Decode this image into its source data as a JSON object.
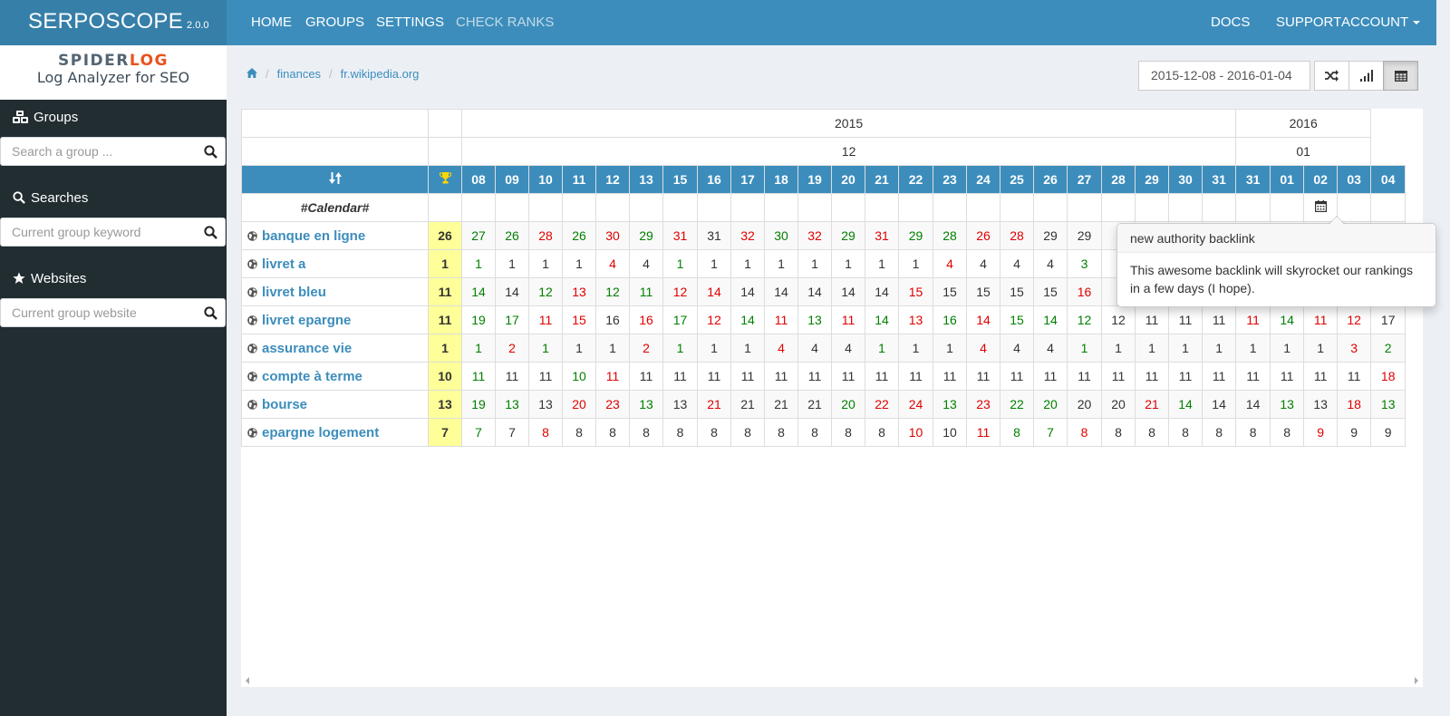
{
  "navbar": {
    "brand": "SERPOSCOPE",
    "version": "2.0.0",
    "left_links": [
      "HOME",
      "GROUPS",
      "SETTINGS",
      "CHECK RANKS"
    ],
    "right_links": [
      "DOCS",
      "SUPPORT",
      "ACCOUNT"
    ]
  },
  "sidebar": {
    "logo_line1_a": "SPIDER",
    "logo_line1_b": "LOG",
    "logo_line2": "Log Analyzer for SEO",
    "groups_label": "Groups",
    "groups_placeholder": "Search a group ...",
    "searches_label": "Searches",
    "searches_placeholder": "Current group keyword",
    "websites_label": "Websites",
    "websites_placeholder": "Current group website"
  },
  "breadcrumb": [
    "finances",
    "fr.wikipedia.org"
  ],
  "toolbar": {
    "daterange": "2015-12-08 - 2016-01-04"
  },
  "table": {
    "years": [
      {
        "label": "2015",
        "span": 23
      },
      {
        "label": "2016",
        "span": 4
      }
    ],
    "months": [
      {
        "label": "12",
        "span": 23
      },
      {
        "label": "01",
        "span": 4
      }
    ],
    "days": [
      "08",
      "09",
      "10",
      "11",
      "12",
      "13",
      "15",
      "16",
      "17",
      "18",
      "19",
      "20",
      "21",
      "22",
      "23",
      "24",
      "25",
      "26",
      "27",
      "28",
      "29",
      "30",
      "31",
      "31",
      "01",
      "02",
      "03",
      "04"
    ],
    "calendar_label": "#Calendar#",
    "calendar_event_index": 25,
    "rows": [
      {
        "keyword": "banque en ligne",
        "best": "26",
        "ranks": [
          "27",
          "26",
          "28",
          "26",
          "30",
          "29",
          "31",
          "31",
          "32",
          "30",
          "32",
          "29",
          "31",
          "29",
          "28",
          "26",
          "28",
          "29",
          "29",
          "",
          "",
          "",
          "",
          "",
          "",
          "",
          "",
          ""
        ],
        "colors": "ggrgrgrnrgrgrggrrn.........."
      },
      {
        "keyword": "livret a",
        "best": "1",
        "ranks": [
          "1",
          "1",
          "1",
          "1",
          "4",
          "4",
          "1",
          "1",
          "1",
          "1",
          "1",
          "1",
          "1",
          "1",
          "4",
          "4",
          "4",
          "4",
          "3",
          "",
          "",
          "",
          "",
          "",
          "",
          "",
          "",
          ""
        ],
        "colors": "gnnnrngnnnnnnnrnnng........."
      },
      {
        "keyword": "livret bleu",
        "best": "11",
        "ranks": [
          "14",
          "14",
          "12",
          "13",
          "12",
          "11",
          "12",
          "14",
          "14",
          "14",
          "14",
          "14",
          "14",
          "15",
          "15",
          "15",
          "15",
          "15",
          "16",
          "",
          "",
          "",
          "",
          "",
          "",
          "",
          "",
          ""
        ],
        "colors": "gngrggrrnnnnnrnnnnr........."
      },
      {
        "keyword": "livret epargne",
        "best": "11",
        "ranks": [
          "19",
          "17",
          "11",
          "15",
          "16",
          "16",
          "17",
          "12",
          "14",
          "11",
          "13",
          "11",
          "14",
          "13",
          "16",
          "14",
          "15",
          "14",
          "12",
          "12",
          "11",
          "11",
          "11",
          "11",
          "14",
          "11",
          "12",
          "17"
        ],
        "colors": "ggrrnrgrgrgrgrgrgggnnnnrgrr"
      },
      {
        "keyword": "assurance vie",
        "best": "1",
        "ranks": [
          "1",
          "2",
          "1",
          "1",
          "1",
          "2",
          "1",
          "1",
          "1",
          "4",
          "4",
          "4",
          "1",
          "1",
          "1",
          "4",
          "4",
          "4",
          "1",
          "1",
          "1",
          "1",
          "1",
          "1",
          "1",
          "1",
          "3",
          "2"
        ],
        "colors": "grgnnrgnnrnngnnrnngnnnnnnnrg"
      },
      {
        "keyword": "compte à terme",
        "best": "10",
        "ranks": [
          "11",
          "11",
          "11",
          "10",
          "11",
          "11",
          "11",
          "11",
          "11",
          "11",
          "11",
          "11",
          "11",
          "11",
          "11",
          "11",
          "11",
          "11",
          "11",
          "11",
          "11",
          "11",
          "11",
          "11",
          "11",
          "11",
          "11",
          "18"
        ],
        "colors": "gnngrnnnnnnnnnnnnnnnnnnnnnnr"
      },
      {
        "keyword": "bourse",
        "best": "13",
        "ranks": [
          "19",
          "13",
          "13",
          "20",
          "23",
          "13",
          "13",
          "21",
          "21",
          "21",
          "21",
          "20",
          "22",
          "24",
          "13",
          "23",
          "22",
          "20",
          "20",
          "20",
          "21",
          "14",
          "14",
          "14",
          "13",
          "13",
          "18",
          "13"
        ],
        "colors": "ggnrrgnrnnngrrgrggnnrgnngnrg"
      },
      {
        "keyword": "epargne logement",
        "best": "7",
        "ranks": [
          "7",
          "7",
          "8",
          "8",
          "8",
          "8",
          "8",
          "8",
          "8",
          "8",
          "8",
          "8",
          "8",
          "10",
          "10",
          "11",
          "8",
          "7",
          "8",
          "8",
          "8",
          "8",
          "8",
          "8",
          "8",
          "9",
          "9",
          "9"
        ],
        "colors": "gnrnnnnnnnnnnrnrggrnnnnnnrnn"
      }
    ]
  },
  "popover": {
    "title": "new authority backlink",
    "body": "This awesome backlink will skyrocket our rankings in a few days (I hope)."
  }
}
